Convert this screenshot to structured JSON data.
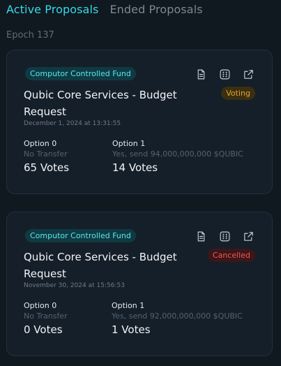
{
  "tabs": [
    {
      "label": "Active Proposals",
      "active": true
    },
    {
      "label": "Ended Proposals",
      "active": false
    }
  ],
  "epoch_label": "Epoch 137",
  "icons": [
    "document-icon",
    "dots-grid-icon",
    "external-link-icon"
  ],
  "colors": {
    "accent": "#38d9e8",
    "voting": "#e2a535",
    "cancelled": "#ec5a5a",
    "fund_badge": "#5ee6f0"
  },
  "proposals": [
    {
      "category": "Computor Controlled Fund",
      "title": "Qubic Core Services - Budget Request",
      "status": "Voting",
      "date": "December 1, 2024 at 13:31:55",
      "options": [
        {
          "label": "Option 0",
          "description": "No Transfer",
          "votes": "65 Votes"
        },
        {
          "label": "Option 1",
          "description": "Yes, send 94,000,000,000 $QUBIC",
          "votes": "14 Votes"
        }
      ]
    },
    {
      "category": "Computor Controlled Fund",
      "title": "Qubic Core Services - Budget Request",
      "status": "Cancelled",
      "date": "November 30, 2024 at 15:56:53",
      "options": [
        {
          "label": "Option 0",
          "description": "No Transfer",
          "votes": "0 Votes"
        },
        {
          "label": "Option 1",
          "description": "Yes, send 92,000,000,000 $QUBIC",
          "votes": "1 Votes"
        }
      ]
    }
  ]
}
